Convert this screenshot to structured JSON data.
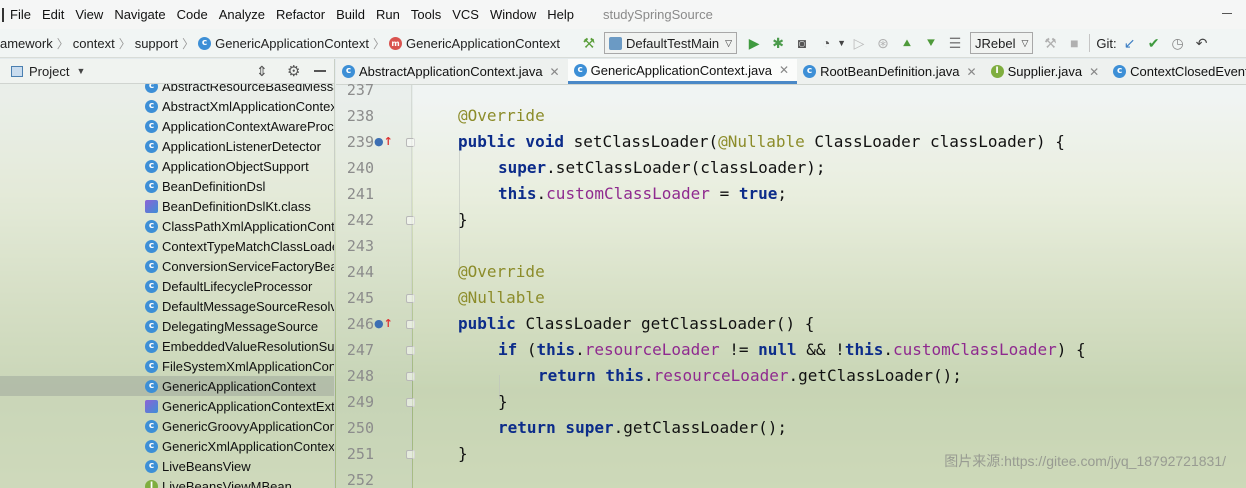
{
  "menubar": {
    "items": [
      "File",
      "Edit",
      "View",
      "Navigate",
      "Code",
      "Analyze",
      "Refactor",
      "Build",
      "Run",
      "Tools",
      "VCS",
      "Window",
      "Help"
    ],
    "project_title": "studySpringSource"
  },
  "navbar": {
    "breadcrumbs": [
      "amework",
      "context",
      "support",
      "GenericApplicationContext",
      "GenericApplicationContext"
    ],
    "run_config": "DefaultTestMain",
    "jrebel": "JRebel",
    "git_label": "Git:"
  },
  "project_panel": {
    "title": "Project",
    "items": [
      {
        "label": "AbstractResourceBasedMessa",
        "icon": "class"
      },
      {
        "label": "AbstractXmlApplicationContex",
        "icon": "class"
      },
      {
        "label": "ApplicationContextAwareProc",
        "icon": "class"
      },
      {
        "label": "ApplicationListenerDetector",
        "icon": "class"
      },
      {
        "label": "ApplicationObjectSupport",
        "icon": "class"
      },
      {
        "label": "BeanDefinitionDsl",
        "icon": "class"
      },
      {
        "label": "BeanDefinitionDslKt.class",
        "icon": "kotlin-class"
      },
      {
        "label": "ClassPathXmlApplicationConte",
        "icon": "class"
      },
      {
        "label": "ContextTypeMatchClassLoade",
        "icon": "class"
      },
      {
        "label": "ConversionServiceFactoryBear",
        "icon": "class"
      },
      {
        "label": "DefaultLifecycleProcessor",
        "icon": "class"
      },
      {
        "label": "DefaultMessageSourceResolv",
        "icon": "class"
      },
      {
        "label": "DelegatingMessageSource",
        "icon": "class"
      },
      {
        "label": "EmbeddedValueResolutionSup",
        "icon": "class"
      },
      {
        "label": "FileSystemXmlApplicationCont",
        "icon": "class"
      },
      {
        "label": "GenericApplicationContext",
        "icon": "class",
        "selected": true
      },
      {
        "label": "GenericApplicationContextExte",
        "icon": "kotlin-class"
      },
      {
        "label": "GenericGroovyApplicationCon",
        "icon": "class"
      },
      {
        "label": "GenericXmlApplicationContext",
        "icon": "class"
      },
      {
        "label": "LiveBeansView",
        "icon": "class"
      },
      {
        "label": "LiveBeansViewMBean",
        "icon": "interface"
      }
    ]
  },
  "tabs": [
    {
      "label": "AbstractApplicationContext.java",
      "icon": "class"
    },
    {
      "label": "GenericApplicationContext.java",
      "icon": "class",
      "active": true
    },
    {
      "label": "RootBeanDefinition.java",
      "icon": "class"
    },
    {
      "label": "Supplier.java",
      "icon": "interface"
    },
    {
      "label": "ContextClosedEvent.",
      "icon": "class"
    }
  ],
  "editor": {
    "line_numbers": [
      "237",
      "238",
      "239",
      "240",
      "241",
      "242",
      "243",
      "244",
      "245",
      "246",
      "247",
      "248",
      "249",
      "250",
      "251",
      "252"
    ],
    "watermark": "图片来源:https://gitee.com/jyq_18792721831/"
  }
}
